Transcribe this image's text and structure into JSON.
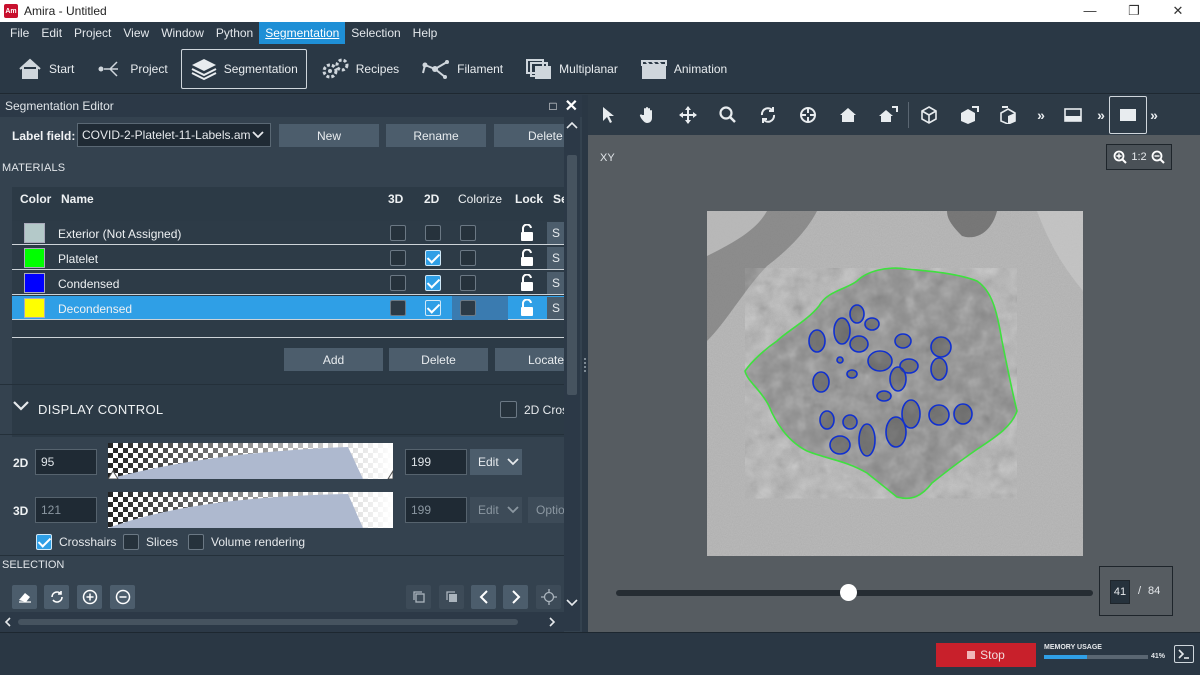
{
  "window": {
    "title": "Amira - Untitled",
    "app_badge": "Am"
  },
  "menu": [
    "File",
    "Edit",
    "Project",
    "View",
    "Window",
    "Python",
    "Segmentation",
    "Selection",
    "Help"
  ],
  "workrooms": {
    "start": "Start",
    "project": "Project",
    "segmentation": "Segmentation",
    "recipes": "Recipes",
    "filament": "Filament",
    "multiplanar": "Multiplanar",
    "animation": "Animation"
  },
  "editor": {
    "title": "Segmentation Editor",
    "label_field_label": "Label field:",
    "label_field_value": "COVID-2-Platelet-11-Labels.am",
    "new_btn": "New",
    "rename_btn": "Rename",
    "delete_btn": "Delete",
    "materials_title": "MATERIALS",
    "columns": {
      "color": "Color",
      "name": "Name",
      "c3d": "3D",
      "c2d": "2D",
      "colorize": "Colorize",
      "lock": "Lock",
      "sel": "Se"
    },
    "materials": [
      {
        "name": "Exterior (Not Assigned)",
        "color": "#b4c9c9",
        "d3": false,
        "d2": false,
        "colorize": false,
        "sel_label": "S"
      },
      {
        "name": "Platelet",
        "color": "#00ff00",
        "d3": false,
        "d2": true,
        "colorize": false,
        "sel_label": "S"
      },
      {
        "name": "Condensed",
        "color": "#0000ff",
        "d3": false,
        "d2": true,
        "colorize": false,
        "sel_label": "S"
      },
      {
        "name": "Decondensed",
        "color": "#ffff00",
        "d3": false,
        "d2": true,
        "colorize": false,
        "sel_label": "S"
      }
    ],
    "add_btn": "Add",
    "delete2_btn": "Delete",
    "locate_btn": "Locate"
  },
  "display_control": {
    "title": "DISPLAY CONTROL",
    "crossfade_label": "2D Cros",
    "row2d": {
      "label": "2D",
      "min": "95",
      "max": "199",
      "edit": "Edit"
    },
    "row3d": {
      "label": "3D",
      "min": "121",
      "max": "199",
      "edit": "Edit",
      "options": "Optio"
    },
    "crosshairs": "Crosshairs",
    "slices": "Slices",
    "volume_rendering": "Volume rendering"
  },
  "selection": {
    "title": "SELECTION"
  },
  "viewer": {
    "view_label": "XY",
    "zoom": "1:2",
    "slice_current": "41",
    "slice_sep": "/",
    "slice_total": "84"
  },
  "status": {
    "stop": "Stop",
    "memory_label": "MEMORY USAGE",
    "memory_pct": "41%",
    "memory_fraction": 0.41
  }
}
